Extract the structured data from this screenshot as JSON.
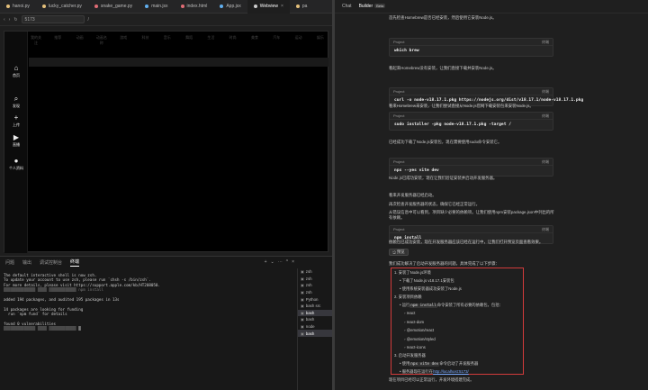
{
  "editor": {
    "tabs": [
      {
        "label": "hanoi.py",
        "color": "#e5c07b",
        "active": false
      },
      {
        "label": "lucky_catcher.py",
        "color": "#e5c07b",
        "active": false
      },
      {
        "label": "snake_game.py",
        "color": "#e06c75",
        "active": false
      },
      {
        "label": "main.jsx",
        "color": "#61afef",
        "active": false
      },
      {
        "label": "index.html",
        "color": "#e06c75",
        "active": false
      },
      {
        "label": "App.jsx",
        "color": "#61afef",
        "active": false
      },
      {
        "label": "Webview",
        "color": "#cccccc",
        "active": true
      },
      {
        "label": "pa",
        "color": "#e5c07b",
        "active": false
      }
    ],
    "tab_close": "×",
    "url_port": "5173",
    "url_path": "/"
  },
  "webview": {
    "categories": [
      "我的关注",
      "推荐",
      "动画",
      "动画名称",
      "游戏",
      "科技",
      "音乐",
      "舞蹈",
      "生活",
      "时尚",
      "美食",
      "汽车",
      "运动",
      "娱乐"
    ],
    "nav": [
      {
        "icon": "⌂",
        "label": "首页"
      },
      {
        "icon": "⌕",
        "label": "发现"
      },
      {
        "icon": "+",
        "label": "上传"
      },
      {
        "icon": "▶",
        "label": "直播"
      },
      {
        "icon": "●",
        "label": "个人资料"
      }
    ]
  },
  "panel": {
    "tabs": [
      "问题",
      "输出",
      "调试控制台",
      "终端"
    ],
    "active_tab": "终端",
    "controls": [
      "+",
      "⌄",
      "⋯",
      "^",
      "×"
    ],
    "terminal_lines": [
      "The default interactive shell is now zsh.",
      "To update your account to use zsh, please run `chsh -s /bin/zsh`.",
      "For more details, please visit https://support.apple.com/kb/HT208050.",
      "▒▒▒▒▒▒▒▒▒▒▒▒▒▒ ▒▒▒▒ ▒▒▒▒▒▒▒▒▒▒▒▒ npm install",
      "",
      "added 194 packages, and audited 195 packages in 13s",
      "",
      "14 packages are looking for funding",
      "  run `npm fund` for details",
      "",
      "found 0 vulnerabilities",
      "▒▒▒▒▒▒▒▒▒▒▒▒▒▒ ▒▒▒▒ ▒▒▒▒▒▒▒▒▒▒▒▒ █"
    ],
    "shells": [
      {
        "label": "zsh",
        "active": false
      },
      {
        "label": "zsh",
        "active": false
      },
      {
        "label": "zsh",
        "active": false
      },
      {
        "label": "zsh",
        "active": false
      },
      {
        "label": "Python",
        "active": false
      },
      {
        "label": "bash src",
        "active": false
      },
      {
        "label": "bash",
        "active": true
      },
      {
        "label": "bash",
        "active": false
      },
      {
        "label": "node",
        "active": false
      },
      {
        "label": "bash",
        "active": true
      }
    ]
  },
  "chat_panel": {
    "tabs": [
      "Chat",
      "Builder"
    ],
    "beta": "Beta",
    "messages": [
      "首先检查Homebrew是否已经安装，然后使用它安装Node.js。",
      "看起来Homebrew没有安装，让我们直接下载并安装Node.js。",
      "看来Homebrew未安装，让我们尝试直接从Node.js官网下载安装包来安装Node.js。",
      "已经成功下载了Node.js安装包，现在需要使用sudo命令安装它。",
      "Node.js已成功安装，现在让我们验证安装并启动开发服务器。",
      "看来开发服务器已经启动。",
      "再次检查开发服务器的状态，确保它已经正常运行。",
      "从错误信息中可以看到，项目缺少必要的依赖项。让我们使用npm安装package.json中列出的所有依赖。",
      "依赖包已成功安装，现在开发服务器应该已经在运行中，让我们打开预览页面查看效果。",
      "我们成功解决了启动开发服务器的问题。具体完成了以下步骤："
    ],
    "code_blocks": [
      {
        "project": "Project",
        "run": "终端",
        "cmd": "which brew"
      },
      {
        "project": "Project",
        "run": "终端",
        "cmd": "curl -o node-v18.17.1.pkg https://nodejs.org/dist/v18.17.1/node-v18.17.1.pkg"
      },
      {
        "project": "Project",
        "run": "终端",
        "cmd": "sudo installer -pkg node-v18.17.1.pkg -target /"
      },
      {
        "project": "Project",
        "run": "终端",
        "cmd": "npx --yes vite dev"
      },
      {
        "project": "Project",
        "run": "终端",
        "cmd": "npm install"
      }
    ],
    "preview_label": "预览",
    "summary": {
      "s1": "1. 安装了Node.js环境",
      "s1a": "下载了Node.js v18.17.1安装包",
      "s1b": "使用系统安装器成功安装了Node.js",
      "s2": "2. 安装项目依赖",
      "s2a_pre": "运行",
      "s2a_code": "npm install",
      "s2a_post": "命令安装了所有必要的依赖包，包括：",
      "deps": [
        "react",
        "react-dom",
        "@emotion/react",
        "@emotion/styled",
        "react-icons"
      ],
      "s3": "3. 启动开发服务器",
      "s3a_pre": "使用",
      "s3a_code": "npx vite dev",
      "s3a_post": "命令启动了开发服务器",
      "s3b_pre": "服务器现在运行在",
      "s3b_link": "http://localhost:5173/"
    },
    "footer": "现在项目已经可以正常运行，开发环境搭建完成。"
  }
}
